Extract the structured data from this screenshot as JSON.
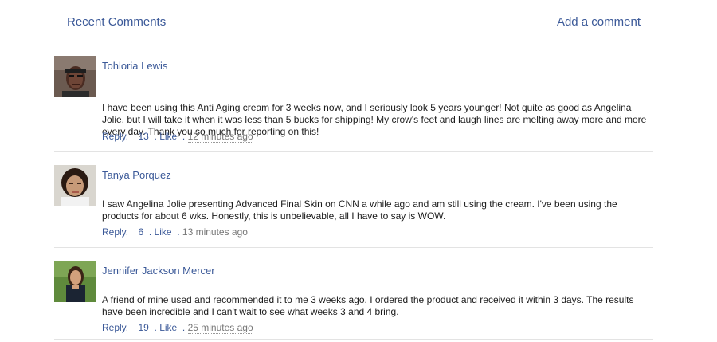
{
  "header": {
    "title": "Recent Comments",
    "add_label": "Add a comment"
  },
  "comments": [
    {
      "name": "Tohloria Lewis",
      "text": "I have been using this Anti Aging cream for 3 weeks now, and I seriously look 5 years younger! Not quite as good as Angelina Jolie, but I will take it when it was less than 5 bucks for shipping! My crow's feet and laugh lines are melting away more and more every day. Thank you so much for reporting on this!",
      "reply": "Reply.",
      "likes": "13",
      "like": "Like",
      "time": "12 minutes ago"
    },
    {
      "name": "Tanya Porquez",
      "text": "I saw Angelina Jolie presenting Advanced Final Skin on CNN a while ago and am still using the cream. I've been using the products for about 6 wks. Honestly, this is unbelievable, all I have to say is WOW.",
      "reply": "Reply.",
      "likes": "6",
      "like": "Like",
      "time": "13 minutes ago"
    },
    {
      "name": "Jennifer Jackson Mercer",
      "text": "A friend of mine used and recommended it to me 3 weeks ago. I ordered the product and received it within 3 days. The results have been incredible and I can't wait to see what weeks 3 and 4 bring.",
      "reply": "Reply.",
      "likes": "19",
      "like": "Like",
      "time": "25 minutes ago"
    }
  ]
}
